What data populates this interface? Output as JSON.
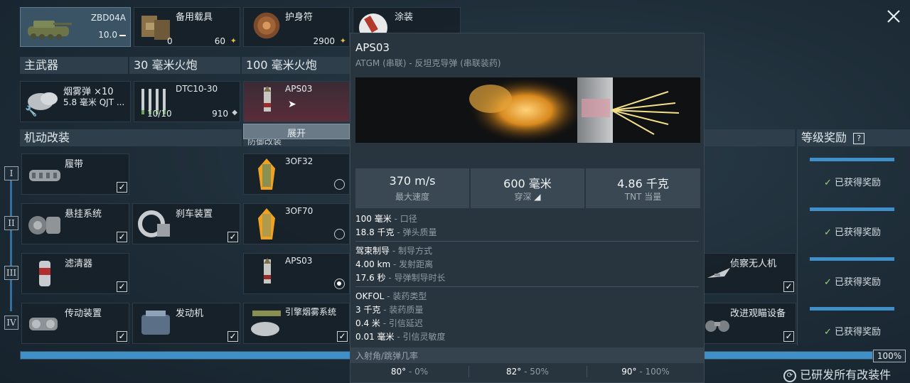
{
  "top": {
    "vehicle": {
      "name": "ZBD04A",
      "br": "10.0"
    },
    "spare": {
      "label": "备用载具",
      "count": "0",
      "price": "60"
    },
    "talisman": {
      "label": "护身符",
      "price": "2900"
    },
    "camo": {
      "label": "涂装"
    }
  },
  "weapons": {
    "headers": [
      "主武器",
      "30 毫米火炮",
      "100 毫米火炮"
    ],
    "smoke": {
      "name": "烟雾弹 ×10",
      "sub": "5.8 毫米 QJT ..."
    },
    "dtc": {
      "name": "DTC10-30",
      "ammo": "10/10",
      "price": "910"
    },
    "aps": {
      "name": "APS03",
      "expand": "展开"
    }
  },
  "mobility": {
    "header": "机动改装",
    "tiers": [
      "I",
      "II",
      "III",
      "IV"
    ],
    "items": [
      {
        "label": "履带",
        "checked": true
      },
      {
        "label": "悬挂系统",
        "checked": true
      },
      {
        "label": "刹车装置",
        "checked": true
      },
      {
        "label": "滤清器",
        "checked": true
      },
      {
        "label": "传动装置",
        "checked": true
      },
      {
        "label": "发动机",
        "checked": true
      }
    ]
  },
  "ammo_col": {
    "partial_header": "防御改装",
    "items": [
      {
        "label": "3OF32",
        "selected": false
      },
      {
        "label": "3OF70",
        "selected": false
      },
      {
        "label": "APS03",
        "selected": true
      },
      {
        "label": "引擎烟雾系统",
        "checked": true
      }
    ]
  },
  "right_col": {
    "items": [
      {
        "label": "侦察无人机",
        "checked": true
      },
      {
        "label": "改进观瞄设备",
        "checked": true
      }
    ]
  },
  "rewards": {
    "header": "等级奖励",
    "help": "?",
    "items": [
      "已获得奖励",
      "已获得奖励",
      "已获得奖励",
      "已获得奖励"
    ]
  },
  "progress": {
    "value_pct": 100,
    "label": "100%"
  },
  "footer": {
    "status": "已研发所有改装件"
  },
  "tooltip": {
    "title": "APS03",
    "subtitle": "ATGM (串联) - 反坦克导弹 (串联装药)",
    "stats": [
      {
        "value": "370 m/s",
        "label": "最大速度"
      },
      {
        "value": "600 毫米",
        "label": "穿深"
      },
      {
        "value": "4.86 千克",
        "label": "TNT 当量"
      }
    ],
    "groups": [
      [
        {
          "v": "100 毫米",
          "k": "口径"
        },
        {
          "v": "18.8 千克",
          "k": "弹头质量"
        }
      ],
      [
        {
          "v": "驾束制导",
          "k": "制导方式"
        },
        {
          "v": "4.00 km",
          "k": "发射距离"
        },
        {
          "v": "17.6 秒",
          "k": "导弹制导时长"
        }
      ],
      [
        {
          "v": "OKFOL",
          "k": "装药类型"
        },
        {
          "v": "3 千克",
          "k": "装药质量"
        },
        {
          "v": "0.4 米",
          "k": "引信延迟"
        },
        {
          "v": "0.01 毫米",
          "k": "引信灵敏度"
        }
      ]
    ],
    "ricochet_title": "入射角/跳弹几率",
    "ricochet": [
      {
        "v": "80°",
        "k": "0%"
      },
      {
        "v": "82°",
        "k": "50%"
      },
      {
        "v": "90°",
        "k": "100%"
      }
    ]
  },
  "colors": {
    "accent": "#3f8fc8",
    "panel": "#28353f",
    "bg": "#1d2c37"
  }
}
